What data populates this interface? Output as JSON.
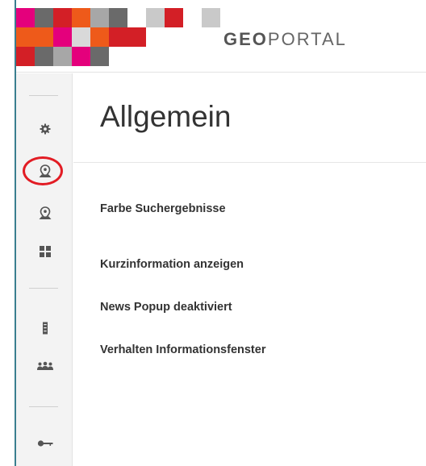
{
  "brand": {
    "logo_bold": "GEO",
    "logo_rest": "PORTAL"
  },
  "colors": {
    "accent": "#e21c24",
    "left_rule": "#3a7e8f"
  },
  "sidebar": {
    "icons": [
      "gear-icon",
      "map-marker-person-icon",
      "map-marker-person-alt-icon",
      "grid-icon",
      "server-icon",
      "users-icon",
      "key-icon"
    ],
    "highlighted": "map-marker-person-icon"
  },
  "main": {
    "title": "Allgemein",
    "settings": [
      "Farbe Suchergebnisse",
      "Kurzinformation anzeigen",
      "News Popup deaktiviert",
      "Verhalten Informationsfenster"
    ]
  }
}
